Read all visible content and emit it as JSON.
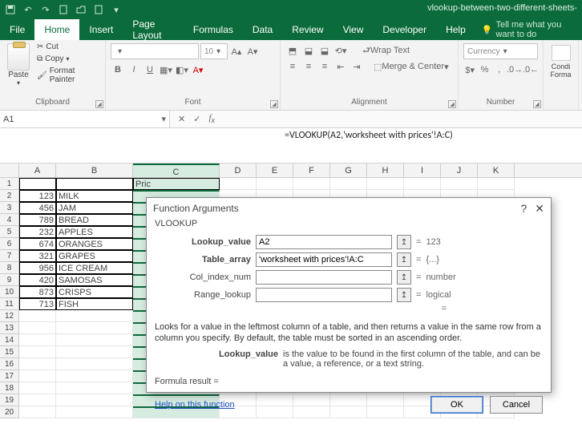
{
  "titlebar": {
    "doc_name": "vlookup-between-two-different-sheets-"
  },
  "tabs": {
    "file": "File",
    "home": "Home",
    "insert": "Insert",
    "page_layout": "Page Layout",
    "formulas": "Formulas",
    "data": "Data",
    "review": "Review",
    "view": "View",
    "developer": "Developer",
    "help": "Help",
    "tell_me": "Tell me what you want to do"
  },
  "ribbon": {
    "clipboard": {
      "paste": "Paste",
      "cut": "Cut",
      "copy": "Copy",
      "format_painter": "Format Painter",
      "label": "Clipboard"
    },
    "font": {
      "size": "10",
      "label": "Font",
      "bold": "B",
      "italic": "I",
      "underline": "U"
    },
    "alignment": {
      "wrap": "Wrap Text",
      "merge": "Merge & Center",
      "label": "Alignment"
    },
    "number": {
      "format": "Currency",
      "label": "Number"
    },
    "styles": {
      "cond": "Condi",
      "cond2": "Forma"
    }
  },
  "name_box": "A1",
  "formula": "=VLOOKUP(A2,'worksheet with prices'!A:C)",
  "columns": [
    "A",
    "B",
    "C",
    "D",
    "E",
    "F",
    "G",
    "H",
    "I",
    "J",
    "K"
  ],
  "cells": {
    "c1": "Pric",
    "rows": [
      {
        "n": "2",
        "a": "123",
        "b": "MILK"
      },
      {
        "n": "3",
        "a": "456",
        "b": "JAM"
      },
      {
        "n": "4",
        "a": "789",
        "b": "BREAD"
      },
      {
        "n": "5",
        "a": "232",
        "b": "APPLES"
      },
      {
        "n": "6",
        "a": "674",
        "b": "ORANGES"
      },
      {
        "n": "7",
        "a": "321",
        "b": "GRAPES"
      },
      {
        "n": "8",
        "a": "956",
        "b": "ICE CREAM"
      },
      {
        "n": "9",
        "a": "420",
        "b": "SAMOSAS"
      },
      {
        "n": "10",
        "a": "873",
        "b": "CRISPS"
      },
      {
        "n": "11",
        "a": "713",
        "b": "FISH"
      }
    ],
    "blank": [
      "12",
      "13",
      "14",
      "15",
      "16",
      "17",
      "18",
      "19",
      "20"
    ]
  },
  "dialog": {
    "title": "Function Arguments",
    "fn": "VLOOKUP",
    "args": {
      "lookup_value": {
        "label": "Lookup_value",
        "value": "A2",
        "result": "123"
      },
      "table_array": {
        "label": "Table_array",
        "value": "'worksheet with prices'!A:C",
        "result": "{...}"
      },
      "col_index_num": {
        "label": "Col_index_num",
        "value": "",
        "result": "number"
      },
      "range_lookup": {
        "label": "Range_lookup",
        "value": "",
        "result": "logical"
      }
    },
    "eq": "=",
    "overall_eq": "=",
    "desc1": "Looks for a value in the leftmost column of a table, and then returns a value in the same row from a column you specify. By default, the table must be sorted in an ascending order.",
    "desc2_label": "Lookup_value",
    "desc2_text": "is the value to be found in the first column of the table, and can be a value, a reference, or a text string.",
    "result_label": "Formula result =",
    "help": "Help on this function",
    "ok": "OK",
    "cancel": "Cancel"
  }
}
